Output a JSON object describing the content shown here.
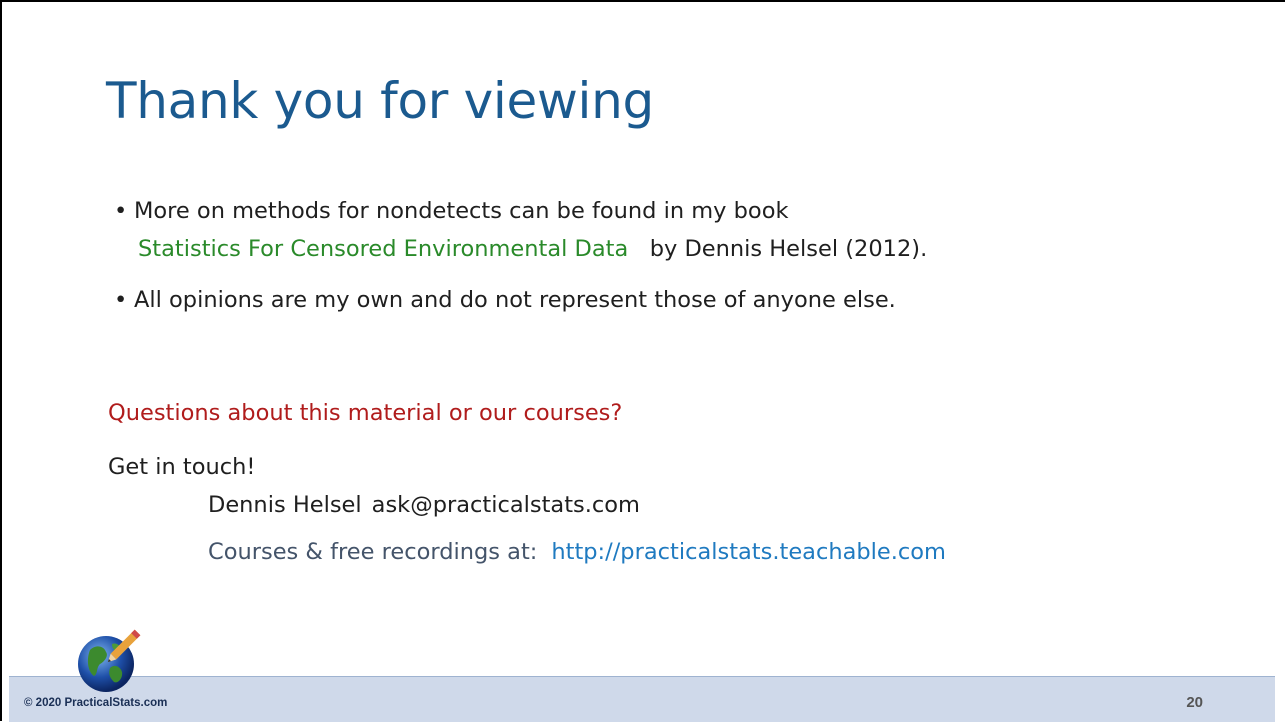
{
  "slide": {
    "title": "Thank you for viewing",
    "bullets": {
      "b1_line1": "More on methods for nondetects can be found in my book",
      "b1_book": "Statistics For Censored Environmental Data",
      "b1_rest": "by Dennis Helsel (2012).",
      "b2": "All opinions are my own and do not represent those of anyone else."
    },
    "questions": "Questions about this material or our courses?",
    "get_in_touch": "Get in touch!",
    "contact_name": "Dennis Helsel",
    "contact_email": "ask@practicalstats.com",
    "courses_label": "Courses & free recordings at:",
    "courses_url": "http://practicalstats.teachable.com"
  },
  "footer": {
    "copyright": "© 2020 PracticalStats.com",
    "page_number": "20"
  },
  "colors": {
    "title": "#1b5a8f",
    "book": "#2a8a2a",
    "questions": "#b01c1c",
    "link": "#1f7ac0",
    "footer_bg": "#cfd9ea"
  },
  "icons": {
    "logo": "globe-pencil-icon"
  }
}
